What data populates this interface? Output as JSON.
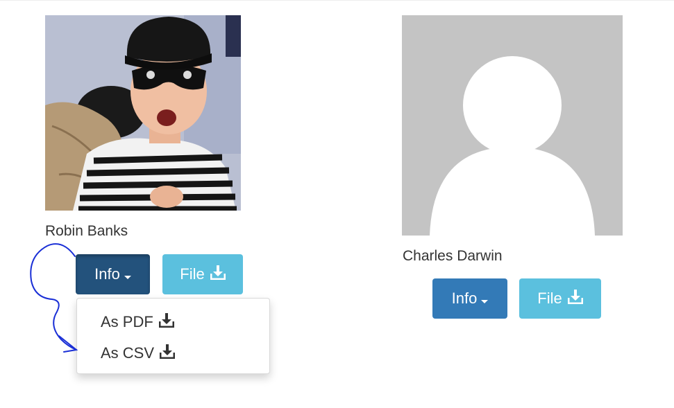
{
  "cards": [
    {
      "name": "Robin Banks",
      "info_label": "Info",
      "file_label": "File",
      "dropdown_items": [
        "As PDF",
        "As CSV"
      ]
    },
    {
      "name": "Charles Darwin",
      "info_label": "Info",
      "file_label": "File"
    }
  ],
  "colors": {
    "primary": "#337ab7",
    "primary_active": "#23527c",
    "info": "#5bc0de",
    "placeholder_bg": "#c4c4c4",
    "annotation": "#1a2fd6"
  },
  "icons": [
    "caret-down-icon",
    "download-icon"
  ]
}
